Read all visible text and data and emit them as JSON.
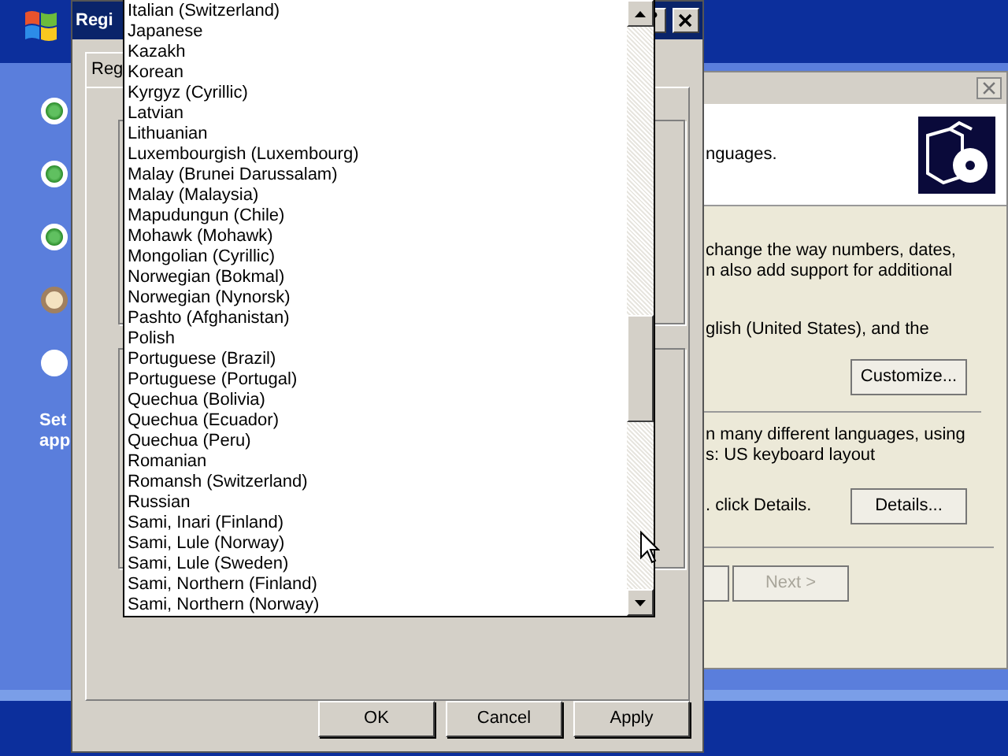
{
  "setup_steps": [
    {
      "kind": "done"
    },
    {
      "kind": "done"
    },
    {
      "kind": "done"
    },
    {
      "kind": "current"
    },
    {
      "kind": "pending"
    }
  ],
  "side_text": [
    "Set",
    "app"
  ],
  "wizard": {
    "header_text": "nguages.",
    "body": [
      {
        "kind": "text",
        "text": "change the way numbers, dates,"
      },
      {
        "kind": "text",
        "text": "n also add support for additional"
      },
      {
        "kind": "text",
        "text": "glish (United States), and the"
      },
      {
        "kind": "button",
        "text": "Customize..."
      },
      {
        "kind": "rule"
      },
      {
        "kind": "text",
        "text": "n many different languages, using"
      },
      {
        "kind": "text",
        "text": "s: US keyboard layout"
      },
      {
        "kind": "textbutton",
        "text": ". click Details.",
        "button": "Details..."
      }
    ],
    "next_button": {
      "label": "Next >",
      "disabled": true
    }
  },
  "dialog": {
    "title": "Regi",
    "tab": "Reg",
    "buttons": [
      "OK",
      "Cancel",
      "Apply"
    ]
  },
  "dropdown": {
    "items": [
      "Italian (Switzerland)",
      "Japanese",
      "Kazakh",
      "Korean",
      "Kyrgyz (Cyrillic)",
      "Latvian",
      "Lithuanian",
      "Luxembourgish (Luxembourg)",
      "Malay (Brunei Darussalam)",
      "Malay (Malaysia)",
      "Mapudungun (Chile)",
      "Mohawk (Mohawk)",
      "Mongolian (Cyrillic)",
      "Norwegian (Bokmal)",
      "Norwegian (Nynorsk)",
      "Pashto (Afghanistan)",
      "Polish",
      "Portuguese (Brazil)",
      "Portuguese (Portugal)",
      "Quechua (Bolivia)",
      "Quechua (Ecuador)",
      "Quechua (Peru)",
      "Romanian",
      "Romansh (Switzerland)",
      "Russian",
      "Sami, Inari (Finland)",
      "Sami, Lule (Norway)",
      "Sami, Lule (Sweden)",
      "Sami, Northern (Finland)",
      "Sami, Northern (Norway)"
    ]
  }
}
